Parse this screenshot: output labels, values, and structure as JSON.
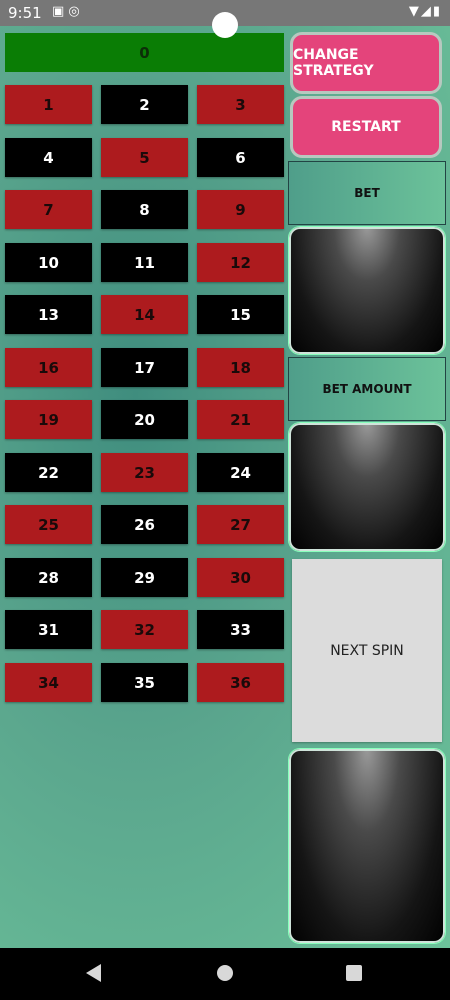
{
  "status": {
    "time": "9:51"
  },
  "board": {
    "zero": "0",
    "rows": [
      [
        {
          "n": "1",
          "c": "red"
        },
        {
          "n": "2",
          "c": "black"
        },
        {
          "n": "3",
          "c": "red"
        }
      ],
      [
        {
          "n": "4",
          "c": "black"
        },
        {
          "n": "5",
          "c": "red"
        },
        {
          "n": "6",
          "c": "black"
        }
      ],
      [
        {
          "n": "7",
          "c": "red"
        },
        {
          "n": "8",
          "c": "black"
        },
        {
          "n": "9",
          "c": "red"
        }
      ],
      [
        {
          "n": "10",
          "c": "black"
        },
        {
          "n": "11",
          "c": "black"
        },
        {
          "n": "12",
          "c": "red"
        }
      ],
      [
        {
          "n": "13",
          "c": "black"
        },
        {
          "n": "14",
          "c": "red"
        },
        {
          "n": "15",
          "c": "black"
        }
      ],
      [
        {
          "n": "16",
          "c": "red"
        },
        {
          "n": "17",
          "c": "black"
        },
        {
          "n": "18",
          "c": "red"
        }
      ],
      [
        {
          "n": "19",
          "c": "red"
        },
        {
          "n": "20",
          "c": "black"
        },
        {
          "n": "21",
          "c": "red"
        }
      ],
      [
        {
          "n": "22",
          "c": "black"
        },
        {
          "n": "23",
          "c": "red"
        },
        {
          "n": "24",
          "c": "black"
        }
      ],
      [
        {
          "n": "25",
          "c": "red"
        },
        {
          "n": "26",
          "c": "black"
        },
        {
          "n": "27",
          "c": "red"
        }
      ],
      [
        {
          "n": "28",
          "c": "black"
        },
        {
          "n": "29",
          "c": "black"
        },
        {
          "n": "30",
          "c": "red"
        }
      ],
      [
        {
          "n": "31",
          "c": "black"
        },
        {
          "n": "32",
          "c": "red"
        },
        {
          "n": "33",
          "c": "black"
        }
      ],
      [
        {
          "n": "34",
          "c": "red"
        },
        {
          "n": "35",
          "c": "black"
        },
        {
          "n": "36",
          "c": "red"
        }
      ]
    ]
  },
  "side": {
    "change_strategy": "CHANGE STRATEGY",
    "restart": "RESTART",
    "bet_label": "BET",
    "bet_amount_label": "BET AMOUNT",
    "next_spin": "NEXT SPIN"
  },
  "colors": {
    "red": "#ad1b1e",
    "black": "#000000",
    "green": "#0a7d05",
    "accent": "#e4447b"
  }
}
